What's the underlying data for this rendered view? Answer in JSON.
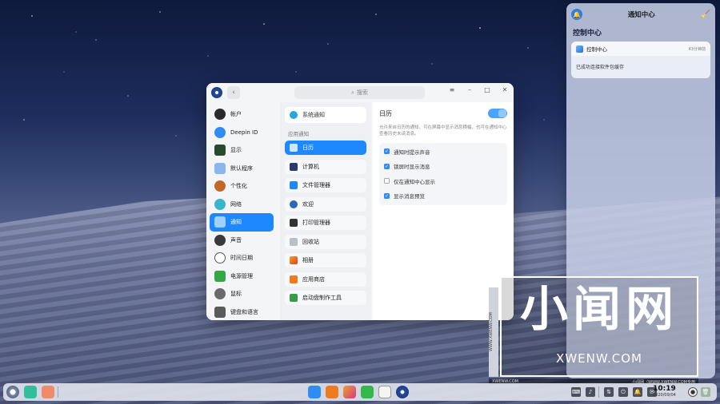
{
  "settings": {
    "search_placeholder": "搜索",
    "sidebar": [
      {
        "label": "帐户",
        "color": "#222"
      },
      {
        "label": "Deepin ID",
        "color": "#1e88ff"
      },
      {
        "label": "显示",
        "color": "#2a6a3a"
      },
      {
        "label": "默认程序",
        "color": "#6aa6e8"
      },
      {
        "label": "个性化",
        "color": "#c46a2a"
      },
      {
        "label": "网络",
        "color": "#3ab0c8"
      },
      {
        "label": "通知",
        "color": "#ffffff"
      },
      {
        "label": "声音",
        "color": "#444"
      },
      {
        "label": "时间日期",
        "color": "#666"
      },
      {
        "label": "电源管理",
        "color": "#2a9a3a"
      },
      {
        "label": "鼠标",
        "color": "#555"
      },
      {
        "label": "键盘和语言",
        "color": "#555"
      }
    ],
    "active_nav": "通知",
    "system_notify": "系统通知",
    "app_notify_label": "应用通知",
    "apps": [
      {
        "label": "日历",
        "color": "#ffffff"
      },
      {
        "label": "计算机",
        "color": "#2a3a6a"
      },
      {
        "label": "文件管理器",
        "color": "#1e88ff"
      },
      {
        "label": "欢迎",
        "color": "#2a6ab0"
      },
      {
        "label": "打印管理器",
        "color": "#333"
      },
      {
        "label": "回收站",
        "color": "#b8c0c8"
      },
      {
        "label": "相册",
        "color": "#e85a2a"
      },
      {
        "label": "应用商店",
        "color": "#f07a20"
      },
      {
        "label": "启动盘制作工具",
        "color": "#3a9a4a"
      }
    ],
    "detail": {
      "title": "日历",
      "description": "允许来自日历的通知，可在屏幕中显示消息横幅，也可在通知中心查看历史未读消息。",
      "options": [
        {
          "label": "通知时提示声音",
          "checked": true
        },
        {
          "label": "锁屏时显示消息",
          "checked": true
        },
        {
          "label": "仅在通知中心显示",
          "checked": false
        },
        {
          "label": "显示消息预览",
          "checked": true
        }
      ]
    }
  },
  "notification_center": {
    "title": "通知中心",
    "section": "控制中心",
    "card": {
      "app": "控制中心",
      "time": "43分钟前",
      "message": "已成功连接软件包缓存"
    }
  },
  "watermark": {
    "big": "小闻网",
    "url": "XWENW.COM",
    "vertical": "WWW.XWENW.COM",
    "bar_left": "XWENW.COM",
    "bar_right": "小闻网（WWW.XWENW.COM专用"
  },
  "taskbar": {
    "time": "10:19",
    "date": "2020/09/04"
  }
}
